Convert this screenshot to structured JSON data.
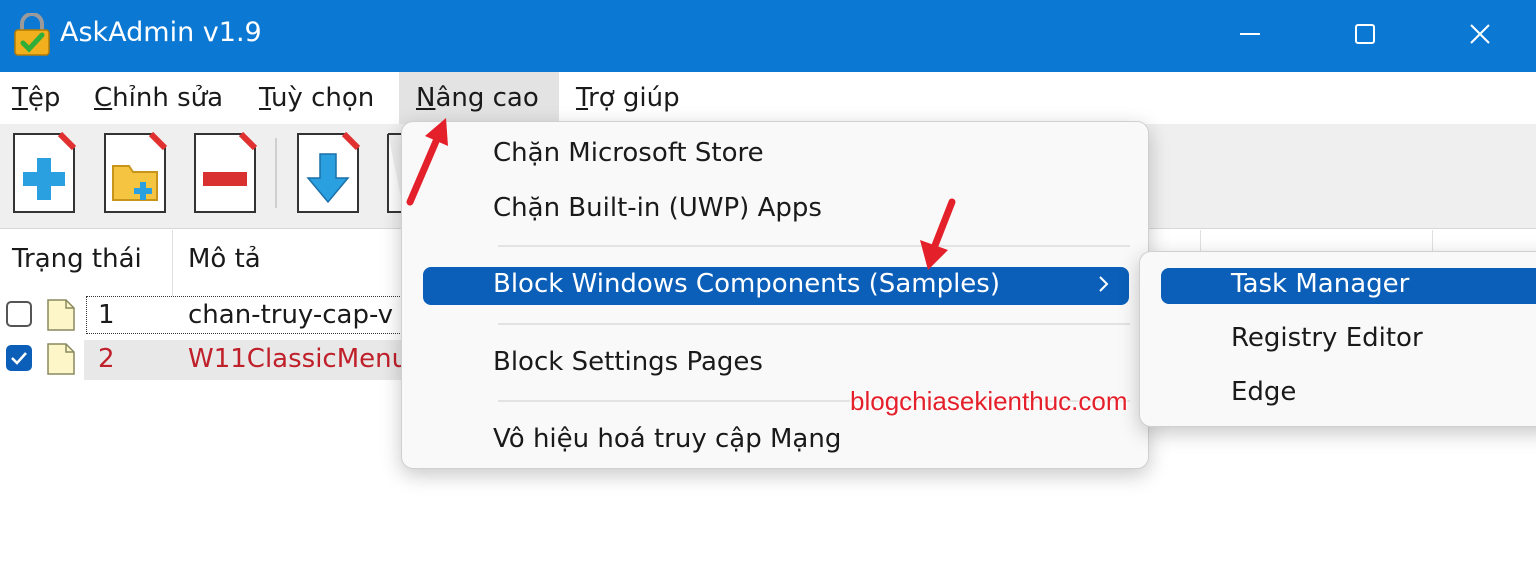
{
  "window": {
    "title": "AskAdmin v1.9"
  },
  "menubar": {
    "items": [
      "Tệp",
      "Chỉnh sửa",
      "Tuỳ chọn",
      "Nâng cao",
      "Trợ giúp"
    ]
  },
  "list": {
    "columns": [
      "Trạng thái",
      "Mô tả"
    ],
    "rows": [
      {
        "number": "1",
        "description": "chan-truy-cap-v",
        "checked": false
      },
      {
        "number": "2",
        "description": "W11ClassicMenu",
        "checked": true
      }
    ]
  },
  "dropdown": {
    "items": [
      "Chặn Microsoft Store",
      "Chặn Built-in (UWP) Apps",
      "Block Windows Components (Samples)",
      "Block Settings Pages",
      "Vô hiệu hoá truy cập Mạng"
    ]
  },
  "submenu": {
    "items": [
      "Task Manager",
      "Registry Editor",
      "Edge"
    ]
  },
  "watermark": "blogchiasekienthuc.com",
  "colors": {
    "titlebar": "#0b78d4",
    "highlight": "#0b5fb8",
    "annotation": "#e4202a"
  }
}
